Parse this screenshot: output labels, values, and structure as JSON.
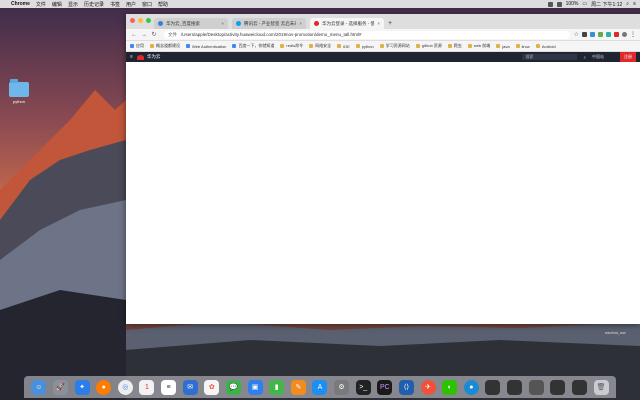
{
  "menubar": {
    "app": "Chrome",
    "items": [
      "文件",
      "编辑",
      "显示",
      "历史记录",
      "书签",
      "用户",
      "窗口",
      "帮助"
    ],
    "battery": "100%",
    "time": "周二 下午1:12"
  },
  "desktop": {
    "folder_label": "python",
    "wechat_label": "wechat_ww"
  },
  "browser": {
    "tabs": [
      {
        "label": "华为云_百度搜索",
        "color": "#3b7ddd"
      },
      {
        "label": "腾讯云 - 产业智变 云启未来",
        "color": "#0aa1e8"
      },
      {
        "label": "华为云登录 - 选择服务 - 使用",
        "color": "#e1282b"
      }
    ],
    "address": {
      "security": "文件",
      "url": "/Users/apple/Desktop/activity.huaweicloud.com/2019nov-promotion/demo_menu_tall.html#"
    },
    "bookmarks": [
      "应用",
      "概念道都建设",
      "Web Authentication",
      "百度一下，你就知道",
      "redis命令",
      "网络安全",
      "IDE",
      "python",
      "学习资源网站",
      "github 资源",
      "爬虫",
      "web 前端",
      "java",
      "linux",
      "Android"
    ]
  },
  "huawei_nav": {
    "brand": "华为云",
    "search_placeholder": "搜索",
    "region": "中国站",
    "register": "注册"
  },
  "colors": {
    "huawei_red": "#e1282b",
    "nav_dark": "#1f2431"
  }
}
